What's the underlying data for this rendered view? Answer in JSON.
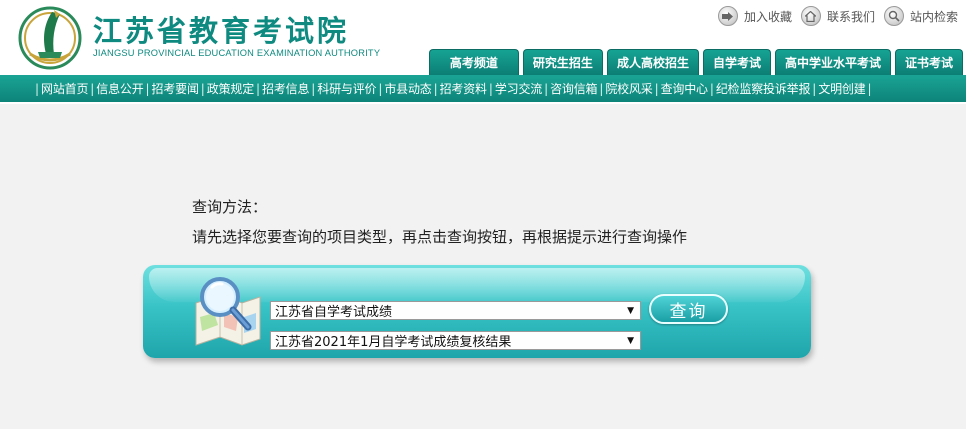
{
  "header": {
    "title_cn": "江苏省教育考试院",
    "title_en": "JIANGSU PROVINCIAL EDUCATION EXAMINATION AUTHORITY"
  },
  "top_links": [
    {
      "label": "加入收藏",
      "icon": "bookmark-icon"
    },
    {
      "label": "联系我们",
      "icon": "home-icon"
    },
    {
      "label": "站内检索",
      "icon": "search-icon"
    }
  ],
  "tabs": [
    "高考频道",
    "研究生招生",
    "成人高校招生",
    "自学考试",
    "高中学业水平考试",
    "证书考试"
  ],
  "nav": [
    "网站首页",
    "信息公开",
    "招考要闻",
    "政策规定",
    "招考信息",
    "科研与评价",
    "市县动态",
    "招考资料",
    "学习交流",
    "咨询信箱",
    "院校风采",
    "查询中心",
    "纪检监察投诉举报",
    "文明创建"
  ],
  "main": {
    "instruction_title": "查询方法：",
    "instruction_text": "请先选择您要查询的项目类型，再点击查询按钮，再根据提示进行查询操作",
    "select_category": "江苏省自学考试成绩",
    "select_item": "江苏省2021年1月自学考试成绩复核结果",
    "query_button": "查询"
  },
  "colors": {
    "brand": "#0e8a80",
    "panel": "#38c3c6"
  }
}
